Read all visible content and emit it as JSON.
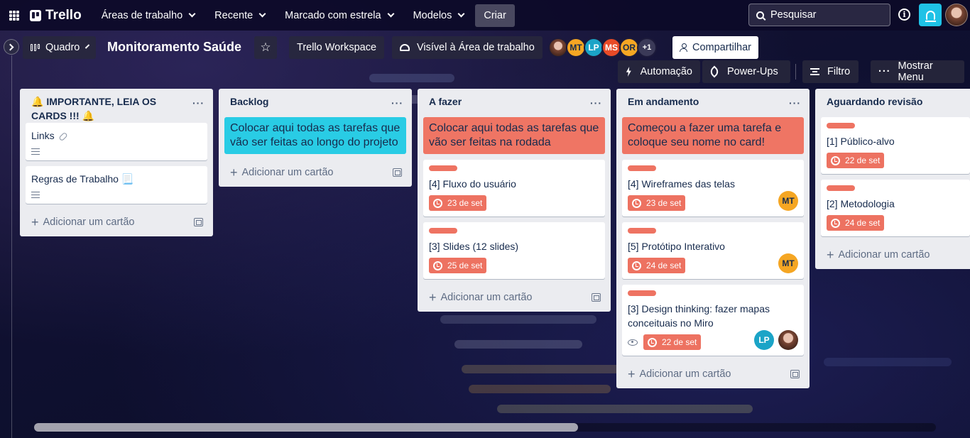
{
  "topnav": {
    "logo": "Trello",
    "menus": [
      "Áreas de trabalho",
      "Recente",
      "Marcado com estrela",
      "Modelos"
    ],
    "create": "Criar",
    "search_placeholder": "Pesquisar",
    "info_glyph": "i"
  },
  "board": {
    "view": "Quadro",
    "title": "Monitoramento Saúde",
    "workspace": "Trello Workspace",
    "visibility": "Visível à Área de trabalho",
    "members": [
      "MT",
      "LP",
      "MS",
      "OR"
    ],
    "more_members": "+1",
    "share": "Compartilhar",
    "automation": "Automação",
    "powerups": "Power-Ups",
    "filter": "Filtro",
    "show_menu": "Mostrar Menu"
  },
  "add_card_label": "Adicionar um cartão",
  "lists": [
    {
      "title": "🔔 IMPORTANTE, LEIA OS CARDS !!! 🔔",
      "cards": [
        {
          "title": "Links"
        },
        {
          "title": "Regras de Trabalho 📃"
        }
      ]
    },
    {
      "title": "Backlog",
      "cover": "Colocar aqui todas as tarefas que vão ser feitas ao longo do projeto"
    },
    {
      "title": "A fazer",
      "cover": "Colocar aqui todas as tarefas que vão ser feitas na rodada",
      "cards": [
        {
          "title": "[4] Fluxo do usuário",
          "due": "23 de set"
        },
        {
          "title": "[3] Slides (12 slides)",
          "due": "25 de set"
        }
      ]
    },
    {
      "title": "Em andamento",
      "cover": "Começou a fazer uma tarefa e coloque seu nome no card!",
      "cards": [
        {
          "title": "[4] Wireframes das telas",
          "due": "23 de set",
          "member": "MT"
        },
        {
          "title": "[5] Protótipo Interativo",
          "due": "24 de set",
          "member": "MT"
        },
        {
          "title": "[3] Design thinking: fazer mapas conceituais no Miro",
          "due": "22 de set",
          "member": "LP"
        }
      ]
    },
    {
      "title": "Aguardando revisão",
      "cards": [
        {
          "title": "[1] Público-alvo",
          "due": "22 de set"
        },
        {
          "title": "[2] Metodologia",
          "due": "24 de set"
        }
      ]
    }
  ],
  "colors": {
    "teal_cover": "#29cce5",
    "coral_cover": "#ef7564",
    "label_red": "#eb5a46",
    "notify_blue": "#1fc2e6"
  }
}
